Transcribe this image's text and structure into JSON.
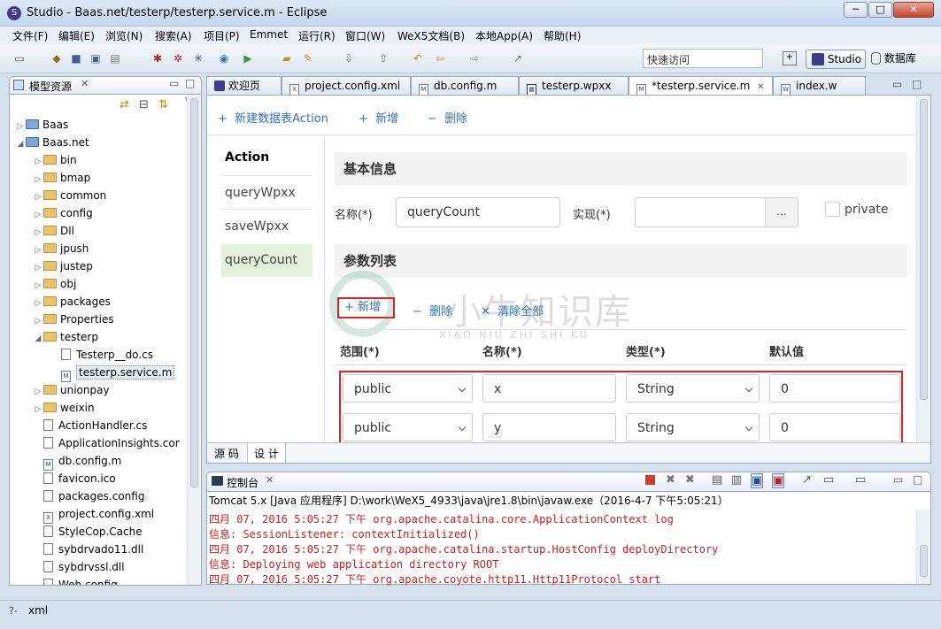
{
  "window": {
    "title": "Studio - Baas.net/testerp/testerp.service.m - Eclipse",
    "minimize": "─",
    "maximize": "□",
    "close": "✕"
  },
  "menu": [
    "文件(F)",
    "编辑(E)",
    "浏览(N)",
    "搜索(A)",
    "项目(P)",
    "Emmet",
    "运行(R)",
    "窗口(W)",
    "WeX5文档(B)",
    "本地App(A)",
    "帮助(H)"
  ],
  "toolbar": {
    "quick_access_placeholder": "快速访问",
    "perspective_studio": "Studio",
    "perspective_db": "数据库"
  },
  "explorer": {
    "title": "模型资源",
    "items": [
      {
        "label": "Baas",
        "kind": "project",
        "arrow": "▷",
        "indent": 0
      },
      {
        "label": "Baas.net",
        "kind": "project",
        "arrow": "◢",
        "indent": 0
      },
      {
        "label": "bin",
        "kind": "folder",
        "arrow": "▷",
        "indent": 1
      },
      {
        "label": "bmap",
        "kind": "folder",
        "arrow": "▷",
        "indent": 1
      },
      {
        "label": "common",
        "kind": "folder",
        "arrow": "▷",
        "indent": 1
      },
      {
        "label": "config",
        "kind": "folder",
        "arrow": "▷",
        "indent": 1
      },
      {
        "label": "Dll",
        "kind": "folder",
        "arrow": "▷",
        "indent": 1
      },
      {
        "label": "jpush",
        "kind": "folder",
        "arrow": "▷",
        "indent": 1
      },
      {
        "label": "justep",
        "kind": "folder",
        "arrow": "▷",
        "indent": 1
      },
      {
        "label": "obj",
        "kind": "folder",
        "arrow": "▷",
        "indent": 1
      },
      {
        "label": "packages",
        "kind": "folder",
        "arrow": "▷",
        "indent": 1
      },
      {
        "label": "Properties",
        "kind": "folder",
        "arrow": "▷",
        "indent": 1
      },
      {
        "label": "testerp",
        "kind": "folder",
        "arrow": "◢",
        "indent": 1
      },
      {
        "label": "Testerp__do.cs",
        "kind": "file",
        "arrow": "",
        "indent": 2
      },
      {
        "label": "testerp.service.m",
        "kind": "file-m",
        "arrow": "",
        "indent": 2,
        "selected": true
      },
      {
        "label": "unionpay",
        "kind": "folder",
        "arrow": "▷",
        "indent": 1
      },
      {
        "label": "weixin",
        "kind": "folder",
        "arrow": "▷",
        "indent": 1
      },
      {
        "label": "ActionHandler.cs",
        "kind": "file",
        "arrow": "",
        "indent": 1
      },
      {
        "label": "ApplicationInsights.cor",
        "kind": "file",
        "arrow": "",
        "indent": 1
      },
      {
        "label": "db.config.m",
        "kind": "file-m",
        "arrow": "",
        "indent": 1
      },
      {
        "label": "favicon.ico",
        "kind": "file",
        "arrow": "",
        "indent": 1
      },
      {
        "label": "packages.config",
        "kind": "file",
        "arrow": "",
        "indent": 1
      },
      {
        "label": "project.config.xml",
        "kind": "file-x",
        "arrow": "",
        "indent": 1
      },
      {
        "label": "StyleCop.Cache",
        "kind": "file",
        "arrow": "",
        "indent": 1
      },
      {
        "label": "sybdrvado11.dll",
        "kind": "file",
        "arrow": "",
        "indent": 1
      },
      {
        "label": "sybdrvssl.dll",
        "kind": "file",
        "arrow": "",
        "indent": 1
      },
      {
        "label": "Web.config",
        "kind": "file",
        "arrow": "",
        "indent": 1
      }
    ]
  },
  "editor_tabs": [
    {
      "label": "欢迎页",
      "active": false,
      "closable": false
    },
    {
      "label": "project.config.xml",
      "active": false,
      "closable": false
    },
    {
      "label": "db.config.m",
      "active": false,
      "closable": false
    },
    {
      "label": "testerp.wpxx",
      "active": false,
      "closable": false
    },
    {
      "label": "*testerp.service.m",
      "active": true,
      "closable": true
    },
    {
      "label": "index.w",
      "active": false,
      "closable": false
    }
  ],
  "editor": {
    "toolbar": {
      "new_table_action": "新建数据表Action",
      "add": "新增",
      "delete": "删除"
    },
    "action_header": "Action",
    "actions": [
      "queryWpxx",
      "saveWpxx",
      "queryCount"
    ],
    "basic_info": {
      "title": "基本信息",
      "name_label": "名称(*)",
      "name_value": "queryCount",
      "impl_label": "实现(*)",
      "impl_value": "",
      "browse": "...",
      "private_label": "private"
    },
    "params": {
      "title": "参数列表",
      "add": "新增",
      "delete": "删除",
      "clear_all": "清除全部",
      "columns": [
        "范围(*)",
        "名称(*)",
        "类型(*)",
        "默认值"
      ],
      "rows": [
        {
          "scope": "public",
          "name": "x",
          "type": "String",
          "default": "0"
        },
        {
          "scope": "public",
          "name": "y",
          "type": "String",
          "default": "0"
        }
      ]
    },
    "bottom_tabs": [
      "源 码",
      "设 计"
    ]
  },
  "watermark": {
    "text": "小牛知识库",
    "subtext": "XIAO NIU ZHI SHI KU"
  },
  "console": {
    "title": "控制台",
    "process": "Tomcat 5.x [Java 应用程序] D:\\work\\WeX5_4933\\java\\jre1.8\\bin\\javaw.exe（2016-4-7 下午5:05:21）",
    "lines": [
      "四月 07, 2016 5:05:27 下午 org.apache.catalina.core.ApplicationContext log",
      "信息: SessionListener: contextInitialized()",
      "四月 07, 2016 5:05:27 下午 org.apache.catalina.startup.HostConfig deployDirectory",
      "信息: Deploying web application directory ROOT",
      "四月 07, 2016 5:05:27 下午 org.apache.coyote.http11.Http11Protocol start"
    ]
  },
  "status": {
    "text": "xml"
  },
  "colors": {
    "accent_blue": "#2f74b9",
    "highlight_red": "#e02222",
    "selected_action_bg": "#e4f1dd",
    "console_red": "#c72020"
  }
}
